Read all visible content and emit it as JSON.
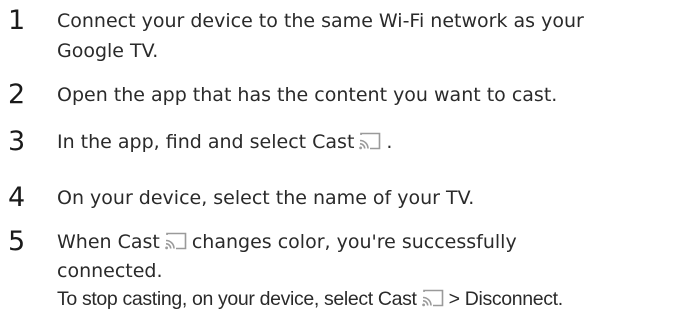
{
  "steps": [
    {
      "number": "1",
      "lines": [
        "Connect your device to the same Wi-Fi network as your",
        "Google TV."
      ]
    },
    {
      "number": "2",
      "lines": [
        "Open the app that has the content you want to cast."
      ]
    },
    {
      "number": "3",
      "text_before_icon": "In the app, find and select Cast",
      "text_after_icon": "."
    },
    {
      "number": "4",
      "lines": [
        "On your device, select the name of your TV."
      ]
    },
    {
      "number": "5",
      "text_before_icon": "When Cast",
      "text_after_icon": "changes color, you're successfully",
      "line2": "connected.",
      "note_before_icon": "To stop casting, on your device, select Cast",
      "note_after_icon": "> Disconnect."
    }
  ],
  "icons": {
    "cast": "cast-icon"
  }
}
